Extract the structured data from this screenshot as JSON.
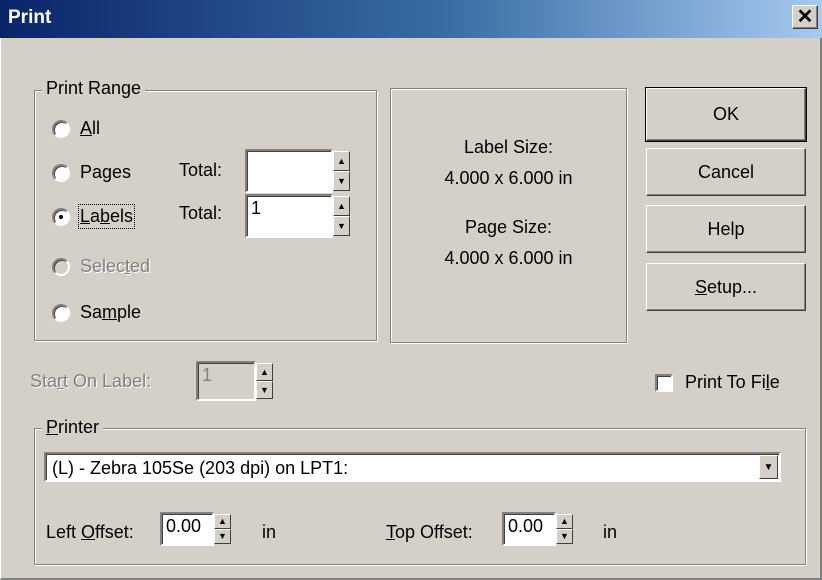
{
  "window": {
    "title": "Print"
  },
  "print_range": {
    "legend": "Print Range",
    "all": {
      "pre": "",
      "key": "A",
      "post": "ll"
    },
    "pages": {
      "label": "Pages",
      "total_label": "Total:",
      "total_value": ""
    },
    "labels": {
      "pre": "",
      "key": "L",
      "mid": "a",
      "key2": "b",
      "post": "els",
      "total_label": "Total:",
      "total_value": "1"
    },
    "selected": {
      "pre": "Selec",
      "key": "t",
      "post": "ed"
    },
    "sample": {
      "pre": "Sa",
      "key": "m",
      "post": "ple"
    },
    "selected_option": "labels"
  },
  "info": {
    "label_size_title": "Label Size:",
    "label_size_value": "4.000 x 6.000 in",
    "page_size_title": "Page Size:",
    "page_size_value": "4.000 x 6.000 in"
  },
  "buttons": {
    "ok": "OK",
    "cancel": "Cancel",
    "help": "Help",
    "setup_key": "S",
    "setup_rest": "etup..."
  },
  "start_on_label": {
    "pre": "Sta",
    "key": "r",
    "post": "t On Label:",
    "value": "1"
  },
  "print_to_file": {
    "pre": "Print To Fi",
    "key": "l",
    "post": "e",
    "checked": false
  },
  "printer": {
    "legend_key": "P",
    "legend_rest": "rinter",
    "selected": "(L) - Zebra 105Se (203 dpi) on LPT1:",
    "left_offset_pre": "Left ",
    "left_offset_key": "O",
    "left_offset_post": "ffset:",
    "left_offset_value": "0.00",
    "left_offset_unit": "in",
    "top_offset_key": "T",
    "top_offset_post": "op Offset:",
    "top_offset_value": "0.00",
    "top_offset_unit": "in"
  },
  "icons": {
    "close": "close-icon",
    "spin_up": "arrow-up-icon",
    "spin_down": "arrow-down-icon",
    "dropdown": "chevron-down-icon"
  }
}
